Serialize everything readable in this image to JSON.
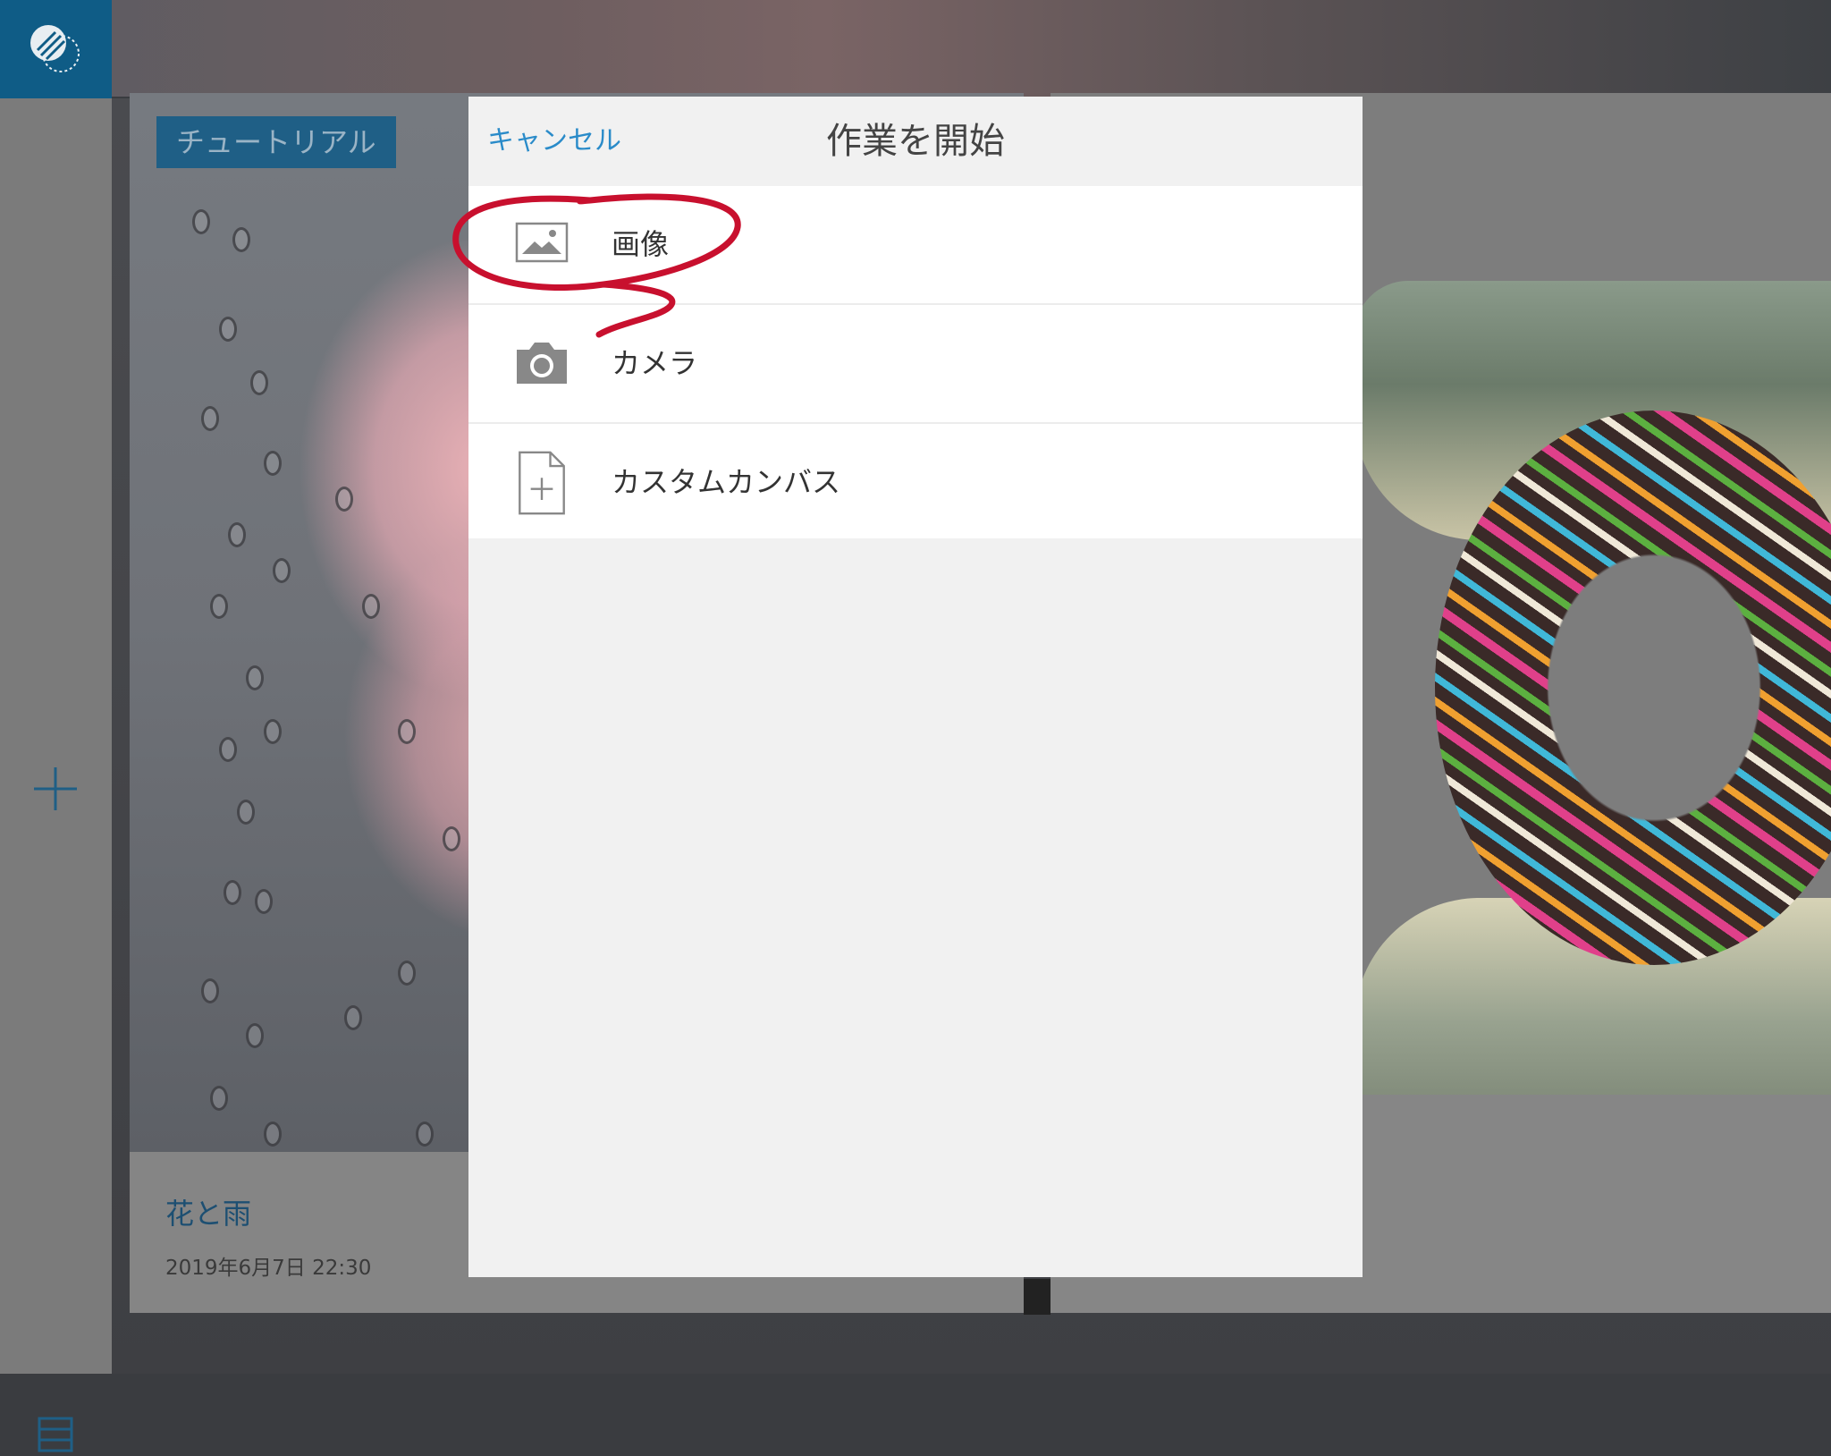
{
  "sidebar": {
    "logo_icon": "app-logo-icon",
    "add_icon": "plus-icon",
    "menu_icon": "list-view-icon"
  },
  "projects": [
    {
      "badge": "チュートリアル",
      "title": "花と雨",
      "date": "2019年6月7日 22:30"
    },
    {
      "badge": "",
      "title": "",
      "date": ""
    }
  ],
  "modal": {
    "cancel_label": "キャンセル",
    "title": "作業を開始",
    "options": [
      {
        "label": "画像",
        "icon": "image-icon"
      },
      {
        "label": "カメラ",
        "icon": "camera-icon"
      },
      {
        "label": "カスタムカンバス",
        "icon": "new-document-icon"
      }
    ]
  },
  "colors": {
    "accent": "#2a8bc9",
    "logo_tile": "#0f5c86",
    "annotation": "#c8102e"
  }
}
